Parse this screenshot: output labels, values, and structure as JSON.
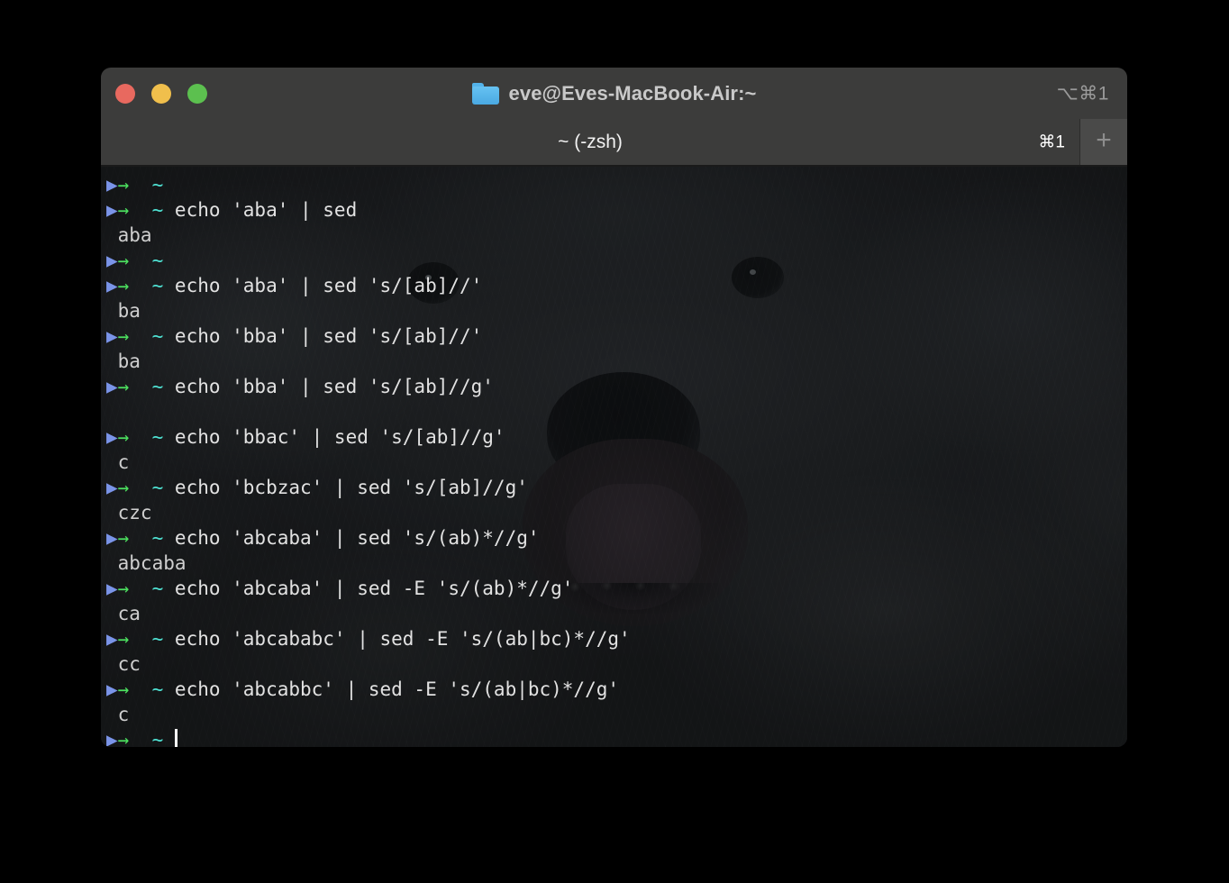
{
  "window": {
    "title": "eve@Eves-MacBook-Air:~",
    "title_icon": "folder-icon",
    "titlebar_shortcut": "⌥⌘1",
    "traffic_lights": [
      {
        "name": "close",
        "color": "#e8695f"
      },
      {
        "name": "minimize",
        "color": "#f0bf4c"
      },
      {
        "name": "zoom",
        "color": "#5cc04f"
      }
    ]
  },
  "tabbar": {
    "tab_title": "~ (-zsh)",
    "tab_shortcut": "⌘1",
    "new_tab_label": "+"
  },
  "prompt": {
    "arrow1": "▶",
    "arrow2": "→",
    "tilde": "~",
    "gap1": "  ",
    "gap2": " "
  },
  "terminal": {
    "shell": "zsh",
    "background_image": "dog-photo",
    "lines": [
      {
        "type": "prompt",
        "command": ""
      },
      {
        "type": "prompt",
        "command": "echo 'aba' | sed"
      },
      {
        "type": "output",
        "text": "aba"
      },
      {
        "type": "prompt",
        "command": ""
      },
      {
        "type": "prompt",
        "command": "echo 'aba' | sed 's/[ab]//'"
      },
      {
        "type": "output",
        "text": "ba"
      },
      {
        "type": "prompt",
        "command": "echo 'bba' | sed 's/[ab]//'"
      },
      {
        "type": "output",
        "text": "ba"
      },
      {
        "type": "prompt",
        "command": "echo 'bba' | sed 's/[ab]//g'"
      },
      {
        "type": "output",
        "text": ""
      },
      {
        "type": "prompt",
        "command": "echo 'bbac' | sed 's/[ab]//g'"
      },
      {
        "type": "output",
        "text": "c"
      },
      {
        "type": "prompt",
        "command": "echo 'bcbzac' | sed 's/[ab]//g'"
      },
      {
        "type": "output",
        "text": "czc"
      },
      {
        "type": "prompt",
        "command": "echo 'abcaba' | sed 's/(ab)*//g'"
      },
      {
        "type": "output",
        "text": "abcaba"
      },
      {
        "type": "prompt",
        "command": "echo 'abcaba' | sed -E 's/(ab)*//g'"
      },
      {
        "type": "output",
        "text": "ca"
      },
      {
        "type": "prompt",
        "command": "echo 'abcababc' | sed -E 's/(ab|bc)*//g'"
      },
      {
        "type": "output",
        "text": "cc"
      },
      {
        "type": "prompt",
        "command": "echo 'abcabbc' | sed -E 's/(ab|bc)*//g'"
      },
      {
        "type": "output",
        "text": "c"
      },
      {
        "type": "prompt",
        "command": "",
        "cursor": true
      }
    ]
  },
  "colors": {
    "titlebar_bg": "#3c3c3b",
    "terminal_bg": "#1c1d1f",
    "desktop_bg": "#000000",
    "prompt_arrow_blue": "#7a94e8",
    "prompt_arrow_green": "#4ce05f",
    "prompt_tilde_cyan": "#4fe3d4",
    "text_fg": "#dcdcdc",
    "cursor": "#ffffff"
  }
}
